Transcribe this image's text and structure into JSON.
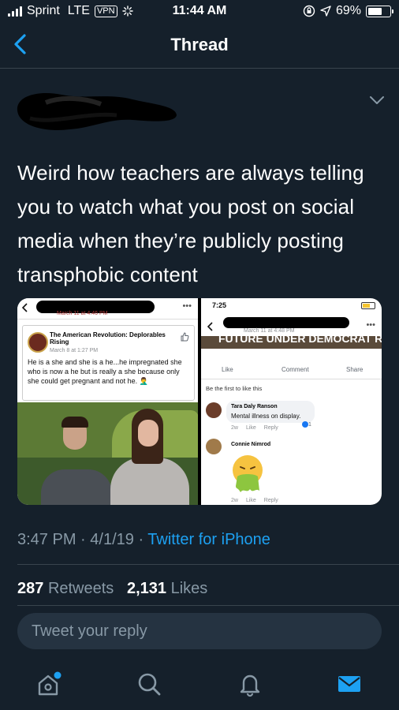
{
  "status_bar": {
    "carrier": "Sprint",
    "network": "LTE",
    "vpn": "VPN",
    "time": "11:44 AM",
    "battery": "69%"
  },
  "nav": {
    "title": "Thread"
  },
  "tweet": {
    "text": "Weird how teachers are always telling you to watch what you post on social media when they’re publicly posting transphobic content",
    "time": "3:47 PM",
    "date": "4/1/19",
    "source": "Twitter for iPhone",
    "retweets_count": "287",
    "retweets_label": "Retweets",
    "likes_count": "2,131",
    "likes_label": "Likes"
  },
  "reply": {
    "placeholder": "Tweet your reply"
  },
  "media_left": {
    "header_date": "March 11 at 4:46 PM",
    "page_name": "The American Revolution: Deplorables Rising",
    "post_date": "March 8 at 1:27 PM",
    "post_text": "He is a she and she is a he...he impregnated she who is now a he but is really a she because only she could get pregnant and not he. 🤦‍♂️"
  },
  "media_right": {
    "time": "7:25",
    "header_date": "March 11 at 4:48 PM",
    "banner_text": "FUTURE UNDER DEMOCRAT RULE",
    "like": "Like",
    "comment": "Comment",
    "share": "Share",
    "first_like": "Be the first to like this",
    "c1_name": "Tara Daly Ranson",
    "c1_text": "Mental illness on display.",
    "c1_age": "2w",
    "c1_like": "Like",
    "c1_reply": "Reply",
    "c1_reactions": "1",
    "c2_name": "Connie Nimrod",
    "c2_age": "2w",
    "c2_like": "Like",
    "c2_reply": "Reply"
  },
  "colors": {
    "background": "#15202b",
    "accent": "#1da1f2",
    "muted": "#8899a6",
    "divider": "#38444d"
  },
  "tab_icons": [
    "home-icon",
    "search-icon",
    "notifications-icon",
    "messages-icon"
  ]
}
